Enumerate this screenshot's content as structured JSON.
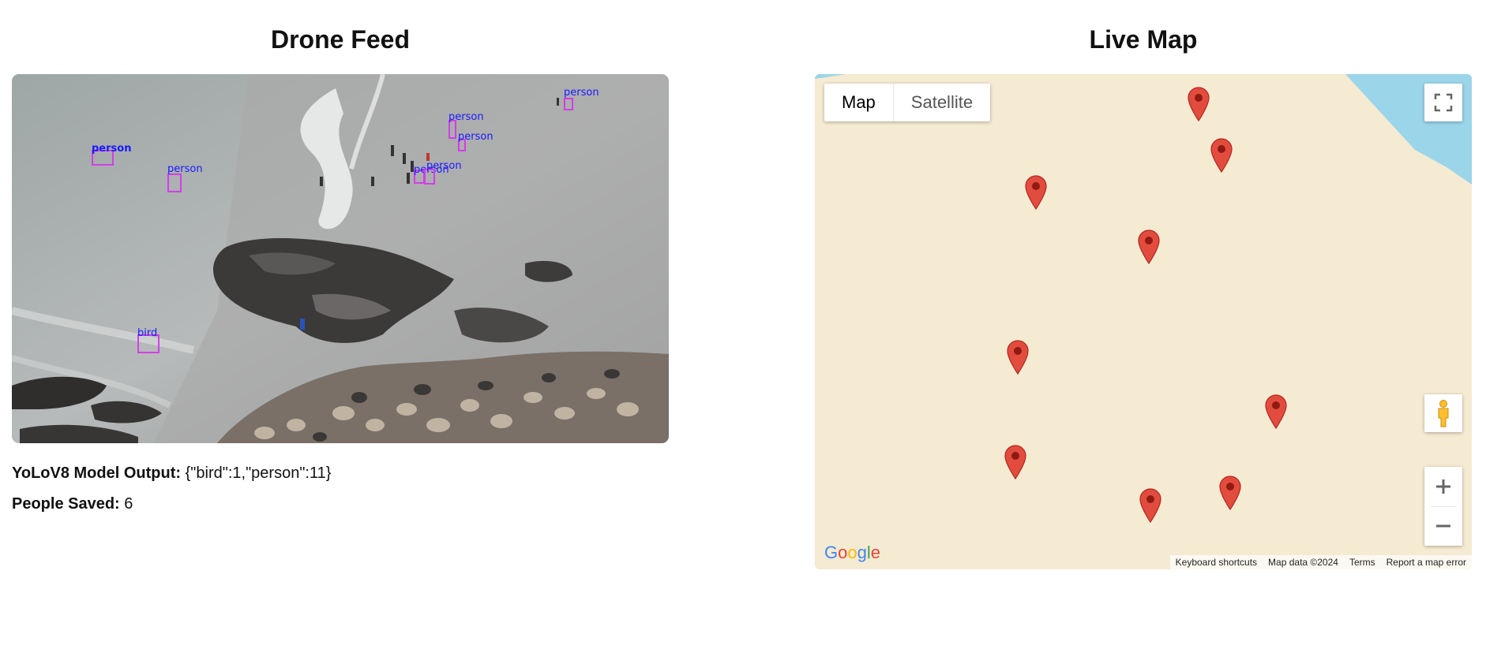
{
  "left": {
    "title": "Drone Feed",
    "detections": [
      {
        "label": "person"
      },
      {
        "label": "person"
      },
      {
        "label": "person"
      },
      {
        "label": "person"
      },
      {
        "label": "person"
      },
      {
        "label": "person"
      },
      {
        "label": "person"
      },
      {
        "label": "bird"
      }
    ],
    "model_output_label": "YoLoV8 Model Output:",
    "model_output_value": "{\"bird\":1,\"person\":11}",
    "people_saved_label": "People Saved:",
    "people_saved_value": "6"
  },
  "right": {
    "title": "Live Map",
    "map_type": {
      "map": "Map",
      "satellite": "Satellite",
      "selected": "Map"
    },
    "logo": "Google",
    "attribution": [
      "Keyboard shortcuts",
      "Map data ©2024",
      "Terms",
      "Report a map error"
    ],
    "marker_count": 9,
    "colors": {
      "land": "#f5ead2",
      "water": "#9bd5ea",
      "marker": "#e24c3f"
    }
  }
}
